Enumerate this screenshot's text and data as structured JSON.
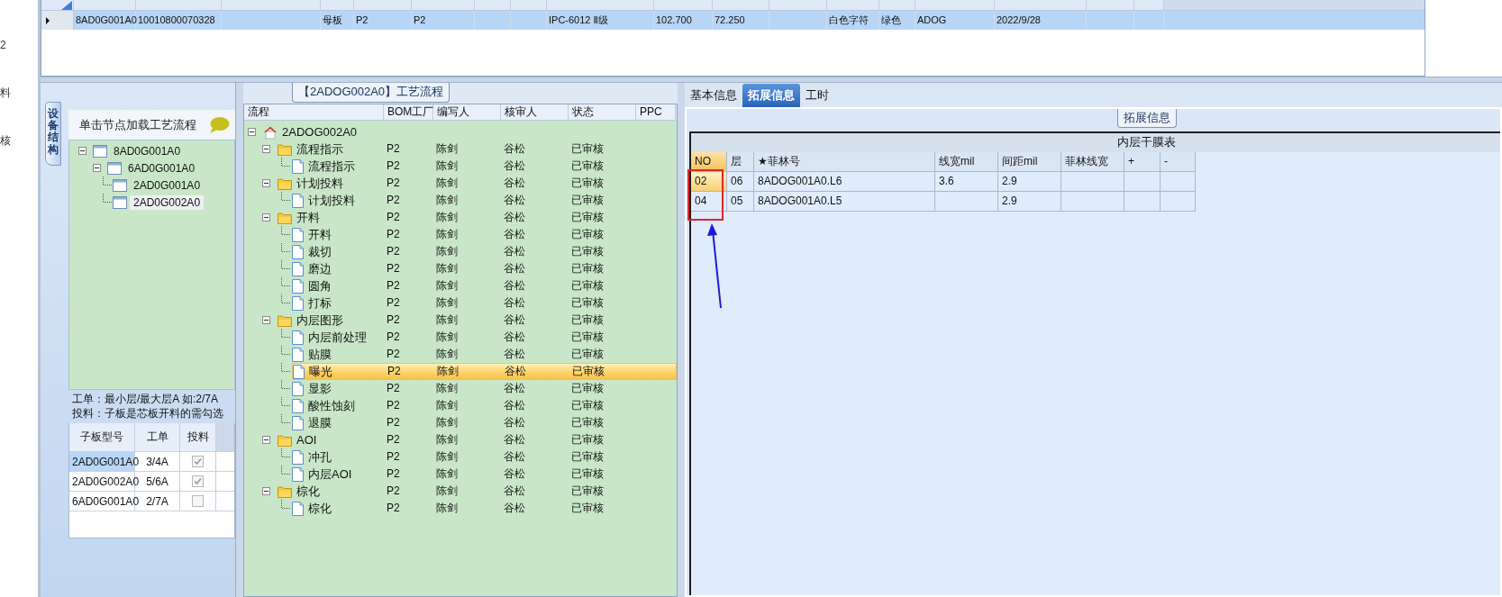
{
  "side_labels": [
    "2",
    "料",
    "核"
  ],
  "top_grid": {
    "rows": [
      {
        "selected": true,
        "cells": [
          "8AD0G001A0",
          "10010800070328",
          null,
          "母板",
          "P2",
          "P2",
          null,
          null,
          "IPC-6012 Ⅱ级",
          "102.700",
          "72.250",
          null,
          "白色字符",
          "绿色",
          "ADOG",
          "2022/9/28",
          null,
          null
        ]
      }
    ]
  },
  "structure_panel": {
    "tab": "设备结构",
    "hint": "单击节点加载工艺流程",
    "tree": [
      {
        "label": "8AD0G001A0",
        "expanded": true,
        "selected": false,
        "children": [
          {
            "label": "6AD0G001A0",
            "expanded": true,
            "selected": false,
            "children": [
              {
                "label": "2AD0G001A0",
                "selected": false
              },
              {
                "label": "2AD0G002A0",
                "selected": true
              }
            ]
          }
        ]
      }
    ],
    "notes": [
      "工单：最小层/最大层A 如:2/7A",
      "投料：子板是芯板开料的需勾选"
    ],
    "sub_grid": {
      "columns": [
        "子板型号",
        "工单",
        "投料"
      ],
      "rows": [
        {
          "model": "2AD0G001A0",
          "work_order": "3/4A",
          "checked": true,
          "selected": true
        },
        {
          "model": "2AD0G002A0",
          "work_order": "5/6A",
          "checked": true,
          "selected": false
        },
        {
          "model": "6AD0G001A0",
          "work_order": "2/7A",
          "checked": false,
          "selected": false
        }
      ]
    }
  },
  "process_panel": {
    "title": "【2ADOG002A0】工艺流程",
    "columns": [
      "流程",
      "BOM工厂",
      "编写人",
      "核审人",
      "状态",
      "PPC"
    ],
    "tree": {
      "label": "2ADOG002A0",
      "kind": "root",
      "expanded": true,
      "selected": false,
      "children": [
        {
          "label": "流程指示",
          "kind": "folder",
          "expanded": true,
          "selected": false,
          "cells": [
            "P2",
            "陈剑",
            "谷松",
            "已审核"
          ],
          "children": [
            {
              "label": "流程指示",
              "kind": "doc",
              "selected": false,
              "cells": [
                "P2",
                "陈剑",
                "谷松",
                "已审核"
              ]
            }
          ]
        },
        {
          "label": "计划投料",
          "kind": "folder",
          "expanded": true,
          "selected": false,
          "cells": [
            "P2",
            "陈剑",
            "谷松",
            "已审核"
          ],
          "children": [
            {
              "label": "计划投料",
              "kind": "doc",
              "selected": false,
              "cells": [
                "P2",
                "陈剑",
                "谷松",
                "已审核"
              ]
            }
          ]
        },
        {
          "label": "开料",
          "kind": "folder",
          "expanded": true,
          "selected": false,
          "cells": [
            "P2",
            "陈剑",
            "谷松",
            "已审核"
          ],
          "children": [
            {
              "label": "开料",
              "kind": "doc",
              "selected": false,
              "cells": [
                "P2",
                "陈剑",
                "谷松",
                "已审核"
              ]
            },
            {
              "label": "裁切",
              "kind": "doc",
              "selected": false,
              "cells": [
                "P2",
                "陈剑",
                "谷松",
                "已审核"
              ]
            },
            {
              "label": "磨边",
              "kind": "doc",
              "selected": false,
              "cells": [
                "P2",
                "陈剑",
                "谷松",
                "已审核"
              ]
            },
            {
              "label": "圆角",
              "kind": "doc",
              "selected": false,
              "cells": [
                "P2",
                "陈剑",
                "谷松",
                "已审核"
              ]
            },
            {
              "label": "打标",
              "kind": "doc",
              "selected": false,
              "cells": [
                "P2",
                "陈剑",
                "谷松",
                "已审核"
              ]
            }
          ]
        },
        {
          "label": "内层图形",
          "kind": "folder",
          "expanded": true,
          "selected": false,
          "cells": [
            "P2",
            "陈剑",
            "谷松",
            "已审核"
          ],
          "children": [
            {
              "label": "内层前处理",
              "kind": "doc",
              "selected": false,
              "cells": [
                "P2",
                "陈剑",
                "谷松",
                "已审核"
              ]
            },
            {
              "label": "贴膜",
              "kind": "doc",
              "selected": false,
              "cells": [
                "P2",
                "陈剑",
                "谷松",
                "已审核"
              ]
            },
            {
              "label": "曝光",
              "kind": "doc",
              "selected": true,
              "cells": [
                "P2",
                "陈剑",
                "谷松",
                "已审核"
              ]
            },
            {
              "label": "显影",
              "kind": "doc",
              "selected": false,
              "cells": [
                "P2",
                "陈剑",
                "谷松",
                "已审核"
              ]
            },
            {
              "label": "酸性蚀刻",
              "kind": "doc",
              "selected": false,
              "cells": [
                "P2",
                "陈剑",
                "谷松",
                "已审核"
              ]
            },
            {
              "label": "退膜",
              "kind": "doc",
              "selected": false,
              "cells": [
                "P2",
                "陈剑",
                "谷松",
                "已审核"
              ]
            }
          ]
        },
        {
          "label": "AOI",
          "kind": "folder",
          "expanded": true,
          "selected": false,
          "cells": [
            "P2",
            "陈剑",
            "谷松",
            "已审核"
          ],
          "children": [
            {
              "label": "冲孔",
              "kind": "doc",
              "selected": false,
              "cells": [
                "P2",
                "陈剑",
                "谷松",
                "已审核"
              ]
            },
            {
              "label": "内层AOI",
              "kind": "doc",
              "selected": false,
              "cells": [
                "P2",
                "陈剑",
                "谷松",
                "已审核"
              ]
            }
          ]
        },
        {
          "label": "棕化",
          "kind": "folder",
          "expanded": true,
          "selected": false,
          "cells": [
            "P2",
            "陈剑",
            "谷松",
            "已审核"
          ],
          "children": [
            {
              "label": "棕化",
              "kind": "doc",
              "selected": false,
              "cells": [
                "P2",
                "陈剑",
                "谷松",
                "已审核"
              ]
            }
          ]
        }
      ]
    }
  },
  "detail_panel": {
    "tabs": [
      {
        "label": "基本信息",
        "selected": false
      },
      {
        "label": "拓展信息",
        "selected": true
      },
      {
        "label": "工时",
        "selected": false
      }
    ],
    "group_title": "拓展信息",
    "table": {
      "title": "内层干膜表",
      "columns": [
        "NO",
        "层",
        "★菲林号",
        "线宽mil",
        "间距mil",
        "菲林线宽",
        "+",
        "-"
      ],
      "rows": [
        {
          "selected": true,
          "cells": [
            "02",
            "06",
            "8ADOG001A0.L6",
            "3.6",
            "2.9",
            null,
            null,
            null
          ]
        },
        {
          "selected": false,
          "cells": [
            "04",
            "05",
            "8ADOG001A0.L5",
            null,
            "2.9",
            null,
            null,
            null
          ]
        }
      ]
    }
  }
}
